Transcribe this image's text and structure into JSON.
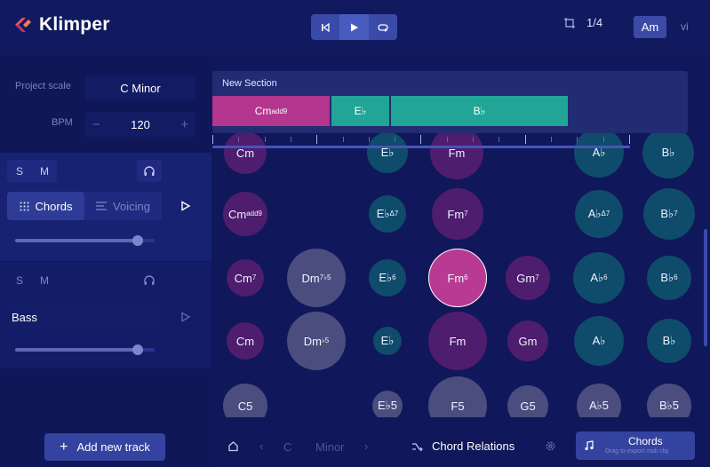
{
  "app": {
    "name": "Klimper"
  },
  "header": {
    "quantize_value": "1/4",
    "key_badge": "Am",
    "degree": "vi"
  },
  "project": {
    "scale_label": "Project scale",
    "scale_value": "C Minor",
    "bpm_label": "BPM",
    "bpm_value": "120",
    "bpm_minus": "−",
    "bpm_plus": "+"
  },
  "tracks": [
    {
      "solo": "S",
      "mute": "M",
      "modes": [
        {
          "label": "Chords",
          "active": true
        },
        {
          "label": "Voicing",
          "active": false
        }
      ],
      "volume": 0.88
    },
    {
      "solo": "S",
      "mute": "M",
      "name": "Bass",
      "volume": 0.88
    }
  ],
  "add_track_label": "Add new track",
  "timeline": {
    "section_title": "New Section",
    "chips": [
      {
        "root": "Cm",
        "ext": "add9",
        "color": "#b3368f"
      },
      {
        "root": "E♭",
        "ext": "",
        "color": "#20a597"
      },
      {
        "root": "B♭",
        "ext": "",
        "color": "#20a597"
      }
    ]
  },
  "chords": [
    {
      "root": "Cm",
      "ext": "",
      "kind": "pur"
    },
    {
      "root": "E♭",
      "ext": "",
      "kind": "teal"
    },
    {
      "root": "Fm",
      "ext": "",
      "kind": "pur"
    },
    {
      "root": "A♭",
      "ext": "",
      "kind": "teal"
    },
    {
      "root": "B♭",
      "ext": "",
      "kind": "teal"
    },
    {
      "root": "Cm",
      "ext": "add9",
      "kind": "pur"
    },
    {
      "root": "E♭",
      "ext": "Δ7",
      "kind": "teal"
    },
    {
      "root": "Fm",
      "ext": "7",
      "kind": "pur"
    },
    {
      "root": "A♭",
      "ext": "Δ7",
      "kind": "teal"
    },
    {
      "root": "B♭",
      "ext": "7",
      "kind": "teal"
    },
    {
      "root": "Cm",
      "ext": "7",
      "kind": "pur"
    },
    {
      "root": "Dm",
      "ext": "7♭5",
      "kind": "gray"
    },
    {
      "root": "E♭",
      "ext": "6",
      "kind": "teal"
    },
    {
      "root": "Fm",
      "ext": "6",
      "kind": "sel"
    },
    {
      "root": "Gm",
      "ext": "7",
      "kind": "pur"
    },
    {
      "root": "A♭",
      "ext": "6",
      "kind": "teal"
    },
    {
      "root": "B♭",
      "ext": "6",
      "kind": "teal"
    },
    {
      "root": "Cm",
      "ext": "",
      "kind": "pur"
    },
    {
      "root": "Dm",
      "ext": "♭5",
      "kind": "gray"
    },
    {
      "root": "E♭",
      "ext": "",
      "kind": "teal"
    },
    {
      "root": "Fm",
      "ext": "",
      "kind": "pur"
    },
    {
      "root": "Gm",
      "ext": "",
      "kind": "pur"
    },
    {
      "root": "A♭",
      "ext": "",
      "kind": "teal"
    },
    {
      "root": "B♭",
      "ext": "",
      "kind": "teal"
    },
    {
      "root": "C5",
      "ext": "",
      "kind": "gray"
    },
    {
      "root": "E♭5",
      "ext": "",
      "kind": "gray"
    },
    {
      "root": "F5",
      "ext": "",
      "kind": "gray"
    },
    {
      "root": "G5",
      "ext": "",
      "kind": "gray"
    },
    {
      "root": "A♭5",
      "ext": "",
      "kind": "gray"
    },
    {
      "root": "B♭5",
      "ext": "",
      "kind": "gray"
    }
  ],
  "footer": {
    "key_root": "C",
    "key_mode": "Minor",
    "relations_label": "Chord Relations",
    "export_title": "Chords",
    "export_sub": "Drag to export midi clip"
  }
}
